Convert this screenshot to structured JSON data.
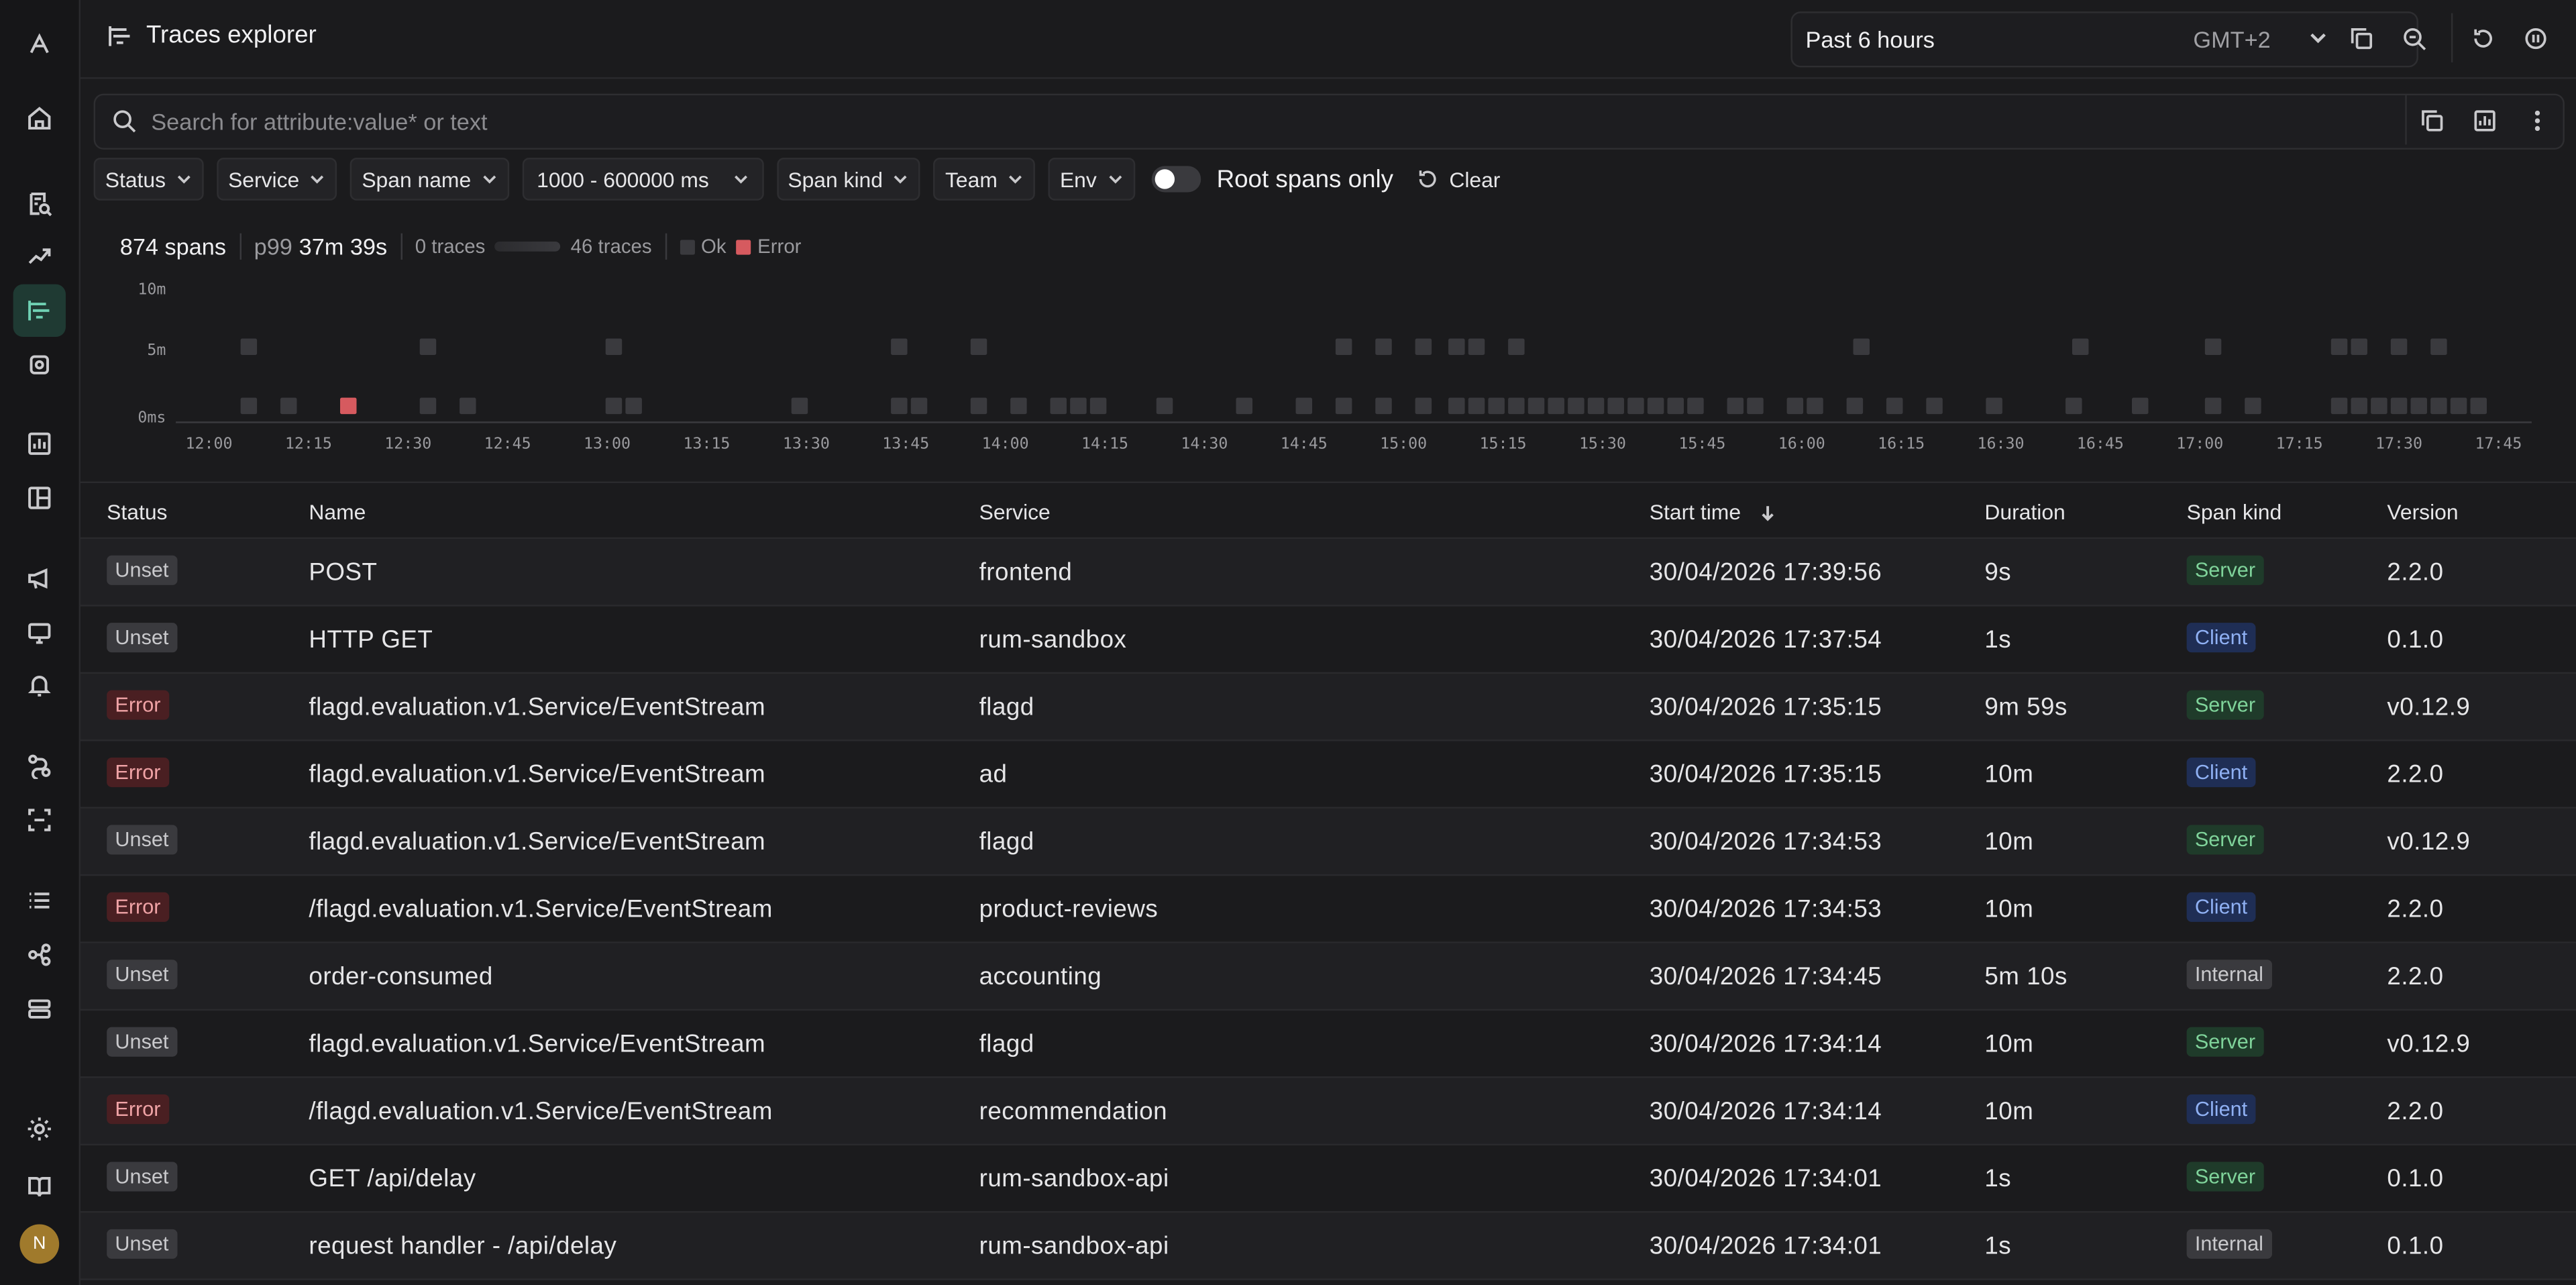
{
  "header": {
    "title": "Traces explorer"
  },
  "timepicker": {
    "range": "Past 6 hours",
    "timezone": "GMT+2"
  },
  "search": {
    "placeholder": "Search for attribute:value* or text"
  },
  "filters": {
    "status": "Status",
    "service": "Service",
    "span_name": "Span name",
    "duration": "1000 - 600000 ms",
    "span_kind": "Span kind",
    "team": "Team",
    "env": "Env",
    "root_only": "Root spans only",
    "clear": "Clear"
  },
  "stats": {
    "spans": "874 spans",
    "p99_label": "p99",
    "p99_value": "37m 39s",
    "traces_min": "0 traces",
    "traces_max": "46 traces",
    "legend_ok": "Ok",
    "legend_error": "Error"
  },
  "colors": {
    "ok": "#3a3a3e",
    "error": "#d65a5f",
    "accent": "#6fd0b3"
  },
  "chart_data": {
    "type": "heatmap",
    "y_ticks": [
      "10m",
      "5m",
      "0ms"
    ],
    "x_ticks": [
      "12:00",
      "12:15",
      "12:30",
      "12:45",
      "13:00",
      "13:15",
      "13:30",
      "13:45",
      "14:00",
      "14:15",
      "14:30",
      "14:45",
      "15:00",
      "15:15",
      "15:30",
      "15:45",
      "16:00",
      "16:15",
      "16:30",
      "16:45",
      "17:00",
      "17:15",
      "17:30",
      "17:45"
    ],
    "x_range": [
      "11:55",
      "17:50"
    ],
    "rows": [
      "5m",
      "0ms"
    ],
    "cells": [
      {
        "t": "12:06",
        "row": "5m",
        "status": "ok"
      },
      {
        "t": "12:33",
        "row": "5m",
        "status": "ok"
      },
      {
        "t": "13:01",
        "row": "5m",
        "status": "ok"
      },
      {
        "t": "13:44",
        "row": "5m",
        "status": "ok"
      },
      {
        "t": "13:56",
        "row": "5m",
        "status": "ok"
      },
      {
        "t": "14:51",
        "row": "5m",
        "status": "ok"
      },
      {
        "t": "14:57",
        "row": "5m",
        "status": "ok"
      },
      {
        "t": "15:03",
        "row": "5m",
        "status": "ok"
      },
      {
        "t": "15:08",
        "row": "5m",
        "status": "ok"
      },
      {
        "t": "15:11",
        "row": "5m",
        "status": "ok"
      },
      {
        "t": "15:17",
        "row": "5m",
        "status": "ok"
      },
      {
        "t": "16:09",
        "row": "5m",
        "status": "ok"
      },
      {
        "t": "16:42",
        "row": "5m",
        "status": "ok"
      },
      {
        "t": "17:02",
        "row": "5m",
        "status": "ok"
      },
      {
        "t": "17:21",
        "row": "5m",
        "status": "ok"
      },
      {
        "t": "17:24",
        "row": "5m",
        "status": "ok"
      },
      {
        "t": "17:30",
        "row": "5m",
        "status": "ok"
      },
      {
        "t": "17:36",
        "row": "5m",
        "status": "ok"
      },
      {
        "t": "12:06",
        "row": "0ms",
        "status": "ok"
      },
      {
        "t": "12:12",
        "row": "0ms",
        "status": "ok"
      },
      {
        "t": "12:21",
        "row": "0ms",
        "status": "error"
      },
      {
        "t": "12:33",
        "row": "0ms",
        "status": "ok"
      },
      {
        "t": "12:39",
        "row": "0ms",
        "status": "ok"
      },
      {
        "t": "13:01",
        "row": "0ms",
        "status": "ok"
      },
      {
        "t": "13:04",
        "row": "0ms",
        "status": "ok"
      },
      {
        "t": "13:29",
        "row": "0ms",
        "status": "ok"
      },
      {
        "t": "13:44",
        "row": "0ms",
        "status": "ok"
      },
      {
        "t": "13:47",
        "row": "0ms",
        "status": "ok"
      },
      {
        "t": "13:56",
        "row": "0ms",
        "status": "ok"
      },
      {
        "t": "14:02",
        "row": "0ms",
        "status": "ok"
      },
      {
        "t": "14:08",
        "row": "0ms",
        "status": "ok"
      },
      {
        "t": "14:11",
        "row": "0ms",
        "status": "ok"
      },
      {
        "t": "14:14",
        "row": "0ms",
        "status": "ok"
      },
      {
        "t": "14:24",
        "row": "0ms",
        "status": "ok"
      },
      {
        "t": "14:36",
        "row": "0ms",
        "status": "ok"
      },
      {
        "t": "14:45",
        "row": "0ms",
        "status": "ok"
      },
      {
        "t": "14:51",
        "row": "0ms",
        "status": "ok"
      },
      {
        "t": "14:57",
        "row": "0ms",
        "status": "ok"
      },
      {
        "t": "15:03",
        "row": "0ms",
        "status": "ok"
      },
      {
        "t": "15:08",
        "row": "0ms",
        "status": "ok"
      },
      {
        "t": "15:11",
        "row": "0ms",
        "status": "ok"
      },
      {
        "t": "15:14",
        "row": "0ms",
        "status": "ok"
      },
      {
        "t": "15:17",
        "row": "0ms",
        "status": "ok"
      },
      {
        "t": "15:20",
        "row": "0ms",
        "status": "ok"
      },
      {
        "t": "15:23",
        "row": "0ms",
        "status": "ok"
      },
      {
        "t": "15:26",
        "row": "0ms",
        "status": "ok"
      },
      {
        "t": "15:29",
        "row": "0ms",
        "status": "ok"
      },
      {
        "t": "15:32",
        "row": "0ms",
        "status": "ok"
      },
      {
        "t": "15:35",
        "row": "0ms",
        "status": "ok"
      },
      {
        "t": "15:38",
        "row": "0ms",
        "status": "ok"
      },
      {
        "t": "15:41",
        "row": "0ms",
        "status": "ok"
      },
      {
        "t": "15:44",
        "row": "0ms",
        "status": "ok"
      },
      {
        "t": "15:50",
        "row": "0ms",
        "status": "ok"
      },
      {
        "t": "15:53",
        "row": "0ms",
        "status": "ok"
      },
      {
        "t": "15:59",
        "row": "0ms",
        "status": "ok"
      },
      {
        "t": "16:02",
        "row": "0ms",
        "status": "ok"
      },
      {
        "t": "16:08",
        "row": "0ms",
        "status": "ok"
      },
      {
        "t": "16:14",
        "row": "0ms",
        "status": "ok"
      },
      {
        "t": "16:20",
        "row": "0ms",
        "status": "ok"
      },
      {
        "t": "16:29",
        "row": "0ms",
        "status": "ok"
      },
      {
        "t": "16:41",
        "row": "0ms",
        "status": "ok"
      },
      {
        "t": "16:51",
        "row": "0ms",
        "status": "ok"
      },
      {
        "t": "17:02",
        "row": "0ms",
        "status": "ok"
      },
      {
        "t": "17:08",
        "row": "0ms",
        "status": "ok"
      },
      {
        "t": "17:21",
        "row": "0ms",
        "status": "ok"
      },
      {
        "t": "17:24",
        "row": "0ms",
        "status": "ok"
      },
      {
        "t": "17:27",
        "row": "0ms",
        "status": "ok"
      },
      {
        "t": "17:30",
        "row": "0ms",
        "status": "ok"
      },
      {
        "t": "17:33",
        "row": "0ms",
        "status": "ok"
      },
      {
        "t": "17:36",
        "row": "0ms",
        "status": "ok"
      },
      {
        "t": "17:39",
        "row": "0ms",
        "status": "ok"
      },
      {
        "t": "17:42",
        "row": "0ms",
        "status": "ok"
      }
    ]
  },
  "table": {
    "columns": [
      "Status",
      "Name",
      "Service",
      "Start time",
      "Duration",
      "Span kind",
      "Version"
    ],
    "rows": [
      {
        "status": "Unset",
        "name": "POST",
        "service": "frontend",
        "start": "30/04/2026 17:39:56",
        "duration": "9s",
        "kind": "Server",
        "version": "2.2.0"
      },
      {
        "status": "Unset",
        "name": "HTTP GET",
        "service": "rum-sandbox",
        "start": "30/04/2026 17:37:54",
        "duration": "1s",
        "kind": "Client",
        "version": "0.1.0"
      },
      {
        "status": "Error",
        "name": "flagd.evaluation.v1.Service/EventStream",
        "service": "flagd",
        "start": "30/04/2026 17:35:15",
        "duration": "9m 59s",
        "kind": "Server",
        "version": "v0.12.9"
      },
      {
        "status": "Error",
        "name": "flagd.evaluation.v1.Service/EventStream",
        "service": "ad",
        "start": "30/04/2026 17:35:15",
        "duration": "10m",
        "kind": "Client",
        "version": "2.2.0"
      },
      {
        "status": "Unset",
        "name": "flagd.evaluation.v1.Service/EventStream",
        "service": "flagd",
        "start": "30/04/2026 17:34:53",
        "duration": "10m",
        "kind": "Server",
        "version": "v0.12.9"
      },
      {
        "status": "Error",
        "name": "/flagd.evaluation.v1.Service/EventStream",
        "service": "product-reviews",
        "start": "30/04/2026 17:34:53",
        "duration": "10m",
        "kind": "Client",
        "version": "2.2.0"
      },
      {
        "status": "Unset",
        "name": "order-consumed",
        "service": "accounting",
        "start": "30/04/2026 17:34:45",
        "duration": "5m 10s",
        "kind": "Internal",
        "version": "2.2.0"
      },
      {
        "status": "Unset",
        "name": "flagd.evaluation.v1.Service/EventStream",
        "service": "flagd",
        "start": "30/04/2026 17:34:14",
        "duration": "10m",
        "kind": "Server",
        "version": "v0.12.9"
      },
      {
        "status": "Error",
        "name": "/flagd.evaluation.v1.Service/EventStream",
        "service": "recommendation",
        "start": "30/04/2026 17:34:14",
        "duration": "10m",
        "kind": "Client",
        "version": "2.2.0"
      },
      {
        "status": "Unset",
        "name": "GET /api/delay",
        "service": "rum-sandbox-api",
        "start": "30/04/2026 17:34:01",
        "duration": "1s",
        "kind": "Server",
        "version": "0.1.0"
      },
      {
        "status": "Unset",
        "name": "request handler - /api/delay",
        "service": "rum-sandbox-api",
        "start": "30/04/2026 17:34:01",
        "duration": "1s",
        "kind": "Internal",
        "version": "0.1.0"
      }
    ]
  },
  "user": {
    "initial": "N"
  }
}
